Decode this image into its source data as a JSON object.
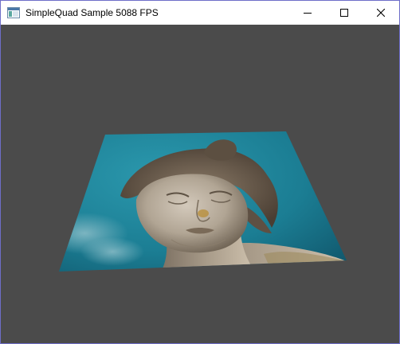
{
  "window": {
    "title": "SimpleQuad Sample 5088 FPS",
    "icon": "window-app-icon",
    "controls": {
      "minimize_icon": "minimize-icon",
      "maximize_icon": "maximize-icon",
      "close_icon": "close-icon"
    }
  },
  "colors": {
    "client_background": "#4b4b4b",
    "sky": "#1f7f95",
    "stone": "#a69a8a",
    "title_border": "#6e6ec8"
  },
  "scene": {
    "quad_texture": "statue-face-texture"
  }
}
